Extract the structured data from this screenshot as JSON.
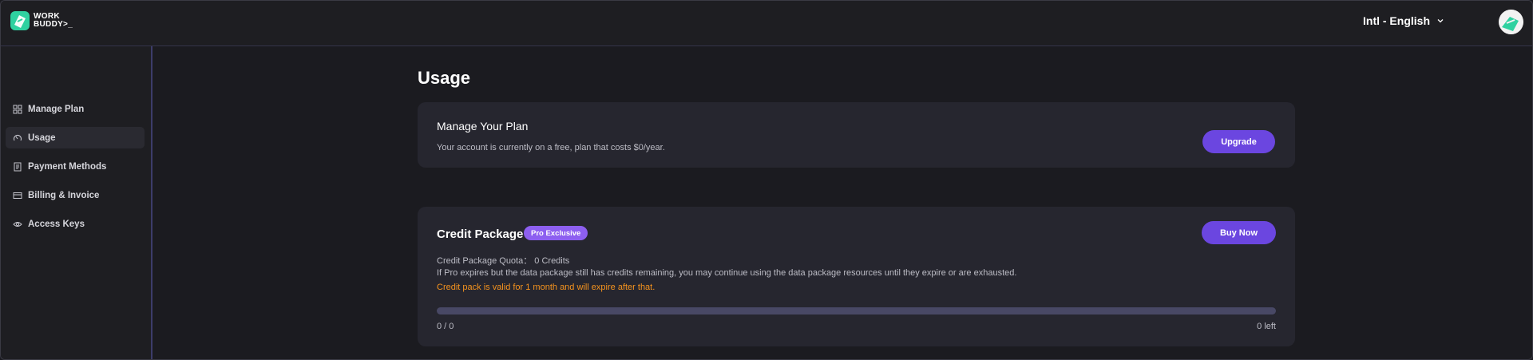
{
  "header": {
    "logo_text_line1": "WORK",
    "logo_text_line2": "BUDDY>_",
    "language": "Intl - English",
    "brand_color": "#2fd1a0"
  },
  "sidebar": {
    "items": [
      {
        "label": "Manage Plan",
        "icon": "grid-icon",
        "active": false
      },
      {
        "label": "Usage",
        "icon": "gauge-icon",
        "active": true
      },
      {
        "label": "Payment Methods",
        "icon": "document-icon",
        "active": false
      },
      {
        "label": "Billing & Invoice",
        "icon": "card-icon",
        "active": false
      },
      {
        "label": "Access Keys",
        "icon": "eye-icon",
        "active": false
      }
    ]
  },
  "main": {
    "page_title": "Usage",
    "plan_card": {
      "title": "Manage Your Plan",
      "description": "Your account is currently on a free, plan that costs $0/year.",
      "upgrade_label": "Upgrade"
    },
    "credit_card": {
      "title": "Credit Package",
      "badge": "Pro Exclusive",
      "buy_label": "Buy Now",
      "quota_line": "Credit Package Quota： 0 Credits",
      "info_line": "If Pro expires but the data package still has credits remaining, you may continue using the data package resources until they expire or are exhausted.",
      "warning_line": "Credit pack is valid for 1 month and will expire after that.",
      "progress": 0,
      "usage_count": "0 / 0",
      "remaining": "0 left"
    }
  },
  "colors": {
    "accent": "#6b46e0",
    "badge": "#8d5ff0",
    "warning": "#f5931e"
  }
}
